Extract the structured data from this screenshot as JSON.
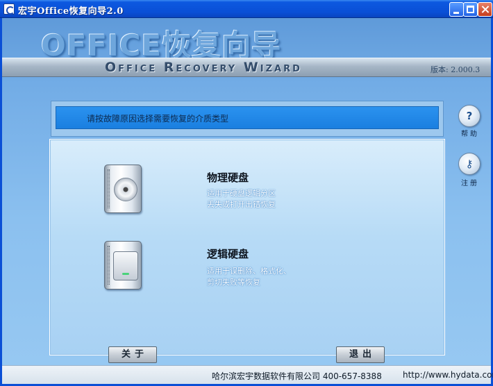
{
  "window": {
    "title": "宏宇Office恢复向导2.0"
  },
  "header": {
    "logo_text": "OFFICE恢复向导",
    "banner_text": "Office Recovery Wizard",
    "version": "版本: 2.000.3"
  },
  "main": {
    "prompt": "请按故障原因选择需要恢复的介质类型",
    "options": [
      {
        "title": "物理硬盘",
        "desc_line1": "适用于硬盘逻辑分区",
        "desc_line2": "丢失或打开出错恢复",
        "icon": "hard-disk-platter-icon"
      },
      {
        "title": "逻辑硬盘",
        "desc_line1": "适用于误删除、格式化、",
        "desc_line2": "剪切失败等恢复",
        "icon": "logical-drive-icon"
      }
    ]
  },
  "buttons": {
    "about": "关于",
    "exit": "退出"
  },
  "side": {
    "help_label": "帮助",
    "help_symbol": "?",
    "register_label": "注册",
    "register_symbol": "⚷"
  },
  "footer": {
    "company": "哈尔滨宏宇数据软件有限公司  400-657-8388",
    "url": "http://www.hydata.com"
  }
}
